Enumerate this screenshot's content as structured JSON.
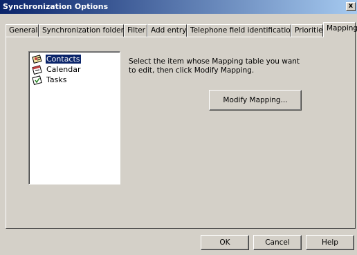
{
  "window": {
    "title": "Synchronization Options",
    "close_label": "x"
  },
  "tabs": [
    {
      "label": "General",
      "active": false
    },
    {
      "label": "Synchronization folder",
      "active": false
    },
    {
      "label": "Filter",
      "active": false
    },
    {
      "label": "Add entry",
      "active": false
    },
    {
      "label": "Telephone field identification",
      "active": false
    },
    {
      "label": "Priorities",
      "active": false
    },
    {
      "label": "Mapping",
      "active": true
    }
  ],
  "list": {
    "items": [
      {
        "label": "Contacts",
        "icon": "contacts-icon",
        "selected": true
      },
      {
        "label": "Calendar",
        "icon": "calendar-icon",
        "selected": false
      },
      {
        "label": "Tasks",
        "icon": "tasks-icon",
        "selected": false
      }
    ]
  },
  "instructions": "Select the item whose Mapping table you want to edit, then click Modify Mapping.",
  "buttons": {
    "modify": "Modify Mapping...",
    "ok": "OK",
    "cancel": "Cancel",
    "help": "Help"
  },
  "colors": {
    "titlebar": "#0a246a",
    "face": "#d4d0c8",
    "selection": "#0a246a"
  }
}
